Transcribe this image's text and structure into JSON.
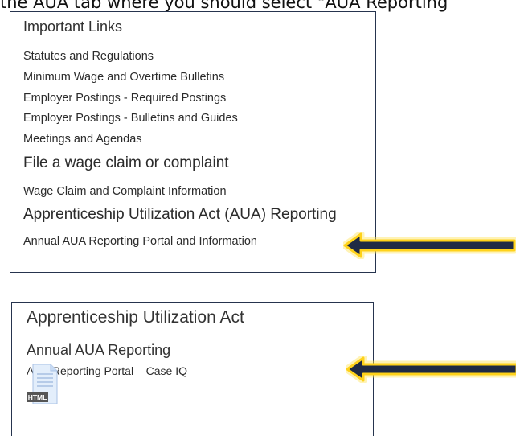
{
  "caption": "the AUA tab where you should select \"AUA Reporting",
  "panel1": {
    "heading": "Important Links",
    "links": [
      "Statutes and Regulations",
      "Minimum Wage and Overtime Bulletins",
      "Employer Postings - Required Postings",
      "Employer Postings - Bulletins and Guides",
      "Meetings and Agendas"
    ],
    "wage_heading": "File a wage claim or complaint",
    "wage_link": "Wage Claim and Complaint Information",
    "aua_heading": "Apprenticeship Utilization Act (AUA) Reporting",
    "aua_link": "Annual AUA Reporting Portal and Information"
  },
  "panel2": {
    "title": "Apprenticeship Utilization Act",
    "subtitle": "Annual AUA Reporting",
    "link": "AUA Reporting Portal – Case IQ",
    "file_badge": "HTML",
    "file_icon": "html-document-icon"
  },
  "colors": {
    "border": "#26344e",
    "arrow_fill": "#1f2a44",
    "arrow_glow": "#ffd21a"
  }
}
